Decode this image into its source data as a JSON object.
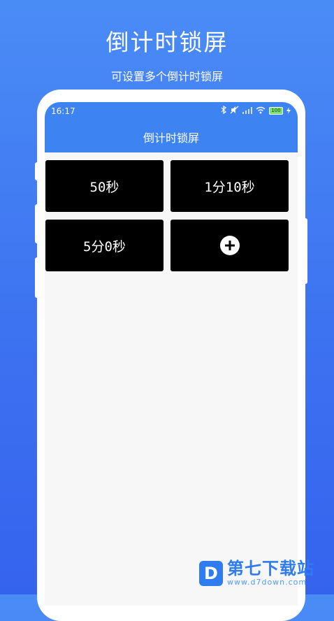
{
  "promo": {
    "title": "倒计时锁屏",
    "subtitle": "可设置多个倒计时锁屏"
  },
  "status_bar": {
    "time": "16:17",
    "battery": "100",
    "icons": [
      "bluetooth-icon",
      "no-sound-icon",
      "signal-icon",
      "wifi-icon",
      "battery-icon",
      "charging-icon"
    ]
  },
  "app_bar": {
    "title": "倒计时锁屏"
  },
  "timers": [
    {
      "label": "50秒"
    },
    {
      "label": "1分10秒"
    },
    {
      "label": "5分0秒"
    }
  ],
  "add_button": {
    "icon": "plus-icon"
  },
  "watermark": {
    "logo": "D",
    "name": "第七下载站",
    "url": "www.d7down.com"
  },
  "colors": {
    "background": "#3d72f0",
    "app_bar": "#3d83f1",
    "tile": "#000000",
    "watermark": "#2f7bf0"
  }
}
